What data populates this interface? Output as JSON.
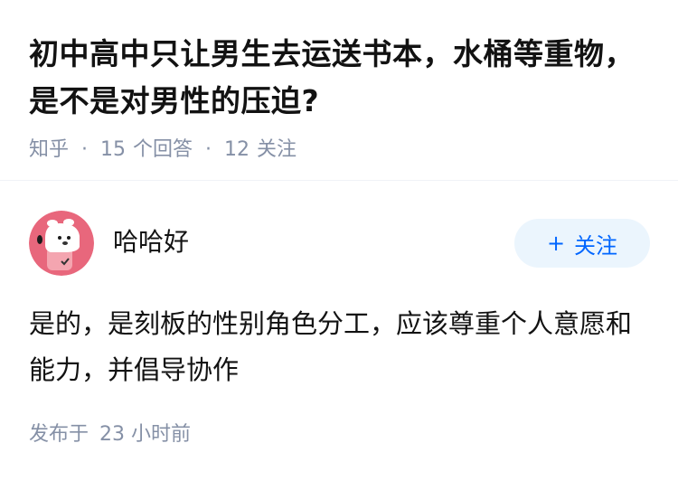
{
  "question": {
    "title": "初中高中只让男生去运送书本，水桶等重物，是不是对男性的压迫?",
    "source": "知乎",
    "answer_count": "15",
    "answer_label": "个回答",
    "follow_count": "12",
    "follow_label": "关注",
    "separator": "·"
  },
  "answer": {
    "author_name": "哈哈好",
    "follow_button_label": "关注",
    "follow_button_icon": "plus-icon",
    "content": "是的，是刻板的性别角色分工，应该尊重个人意愿和能力，并倡导协作",
    "time_prefix": "发布于",
    "time_value": "23 小时前"
  },
  "colors": {
    "title": "#121212",
    "meta": "#8590a6",
    "follow_bg": "#ebf5fd",
    "follow_text": "#0066ff",
    "avatar_bg": "#e8677c"
  }
}
